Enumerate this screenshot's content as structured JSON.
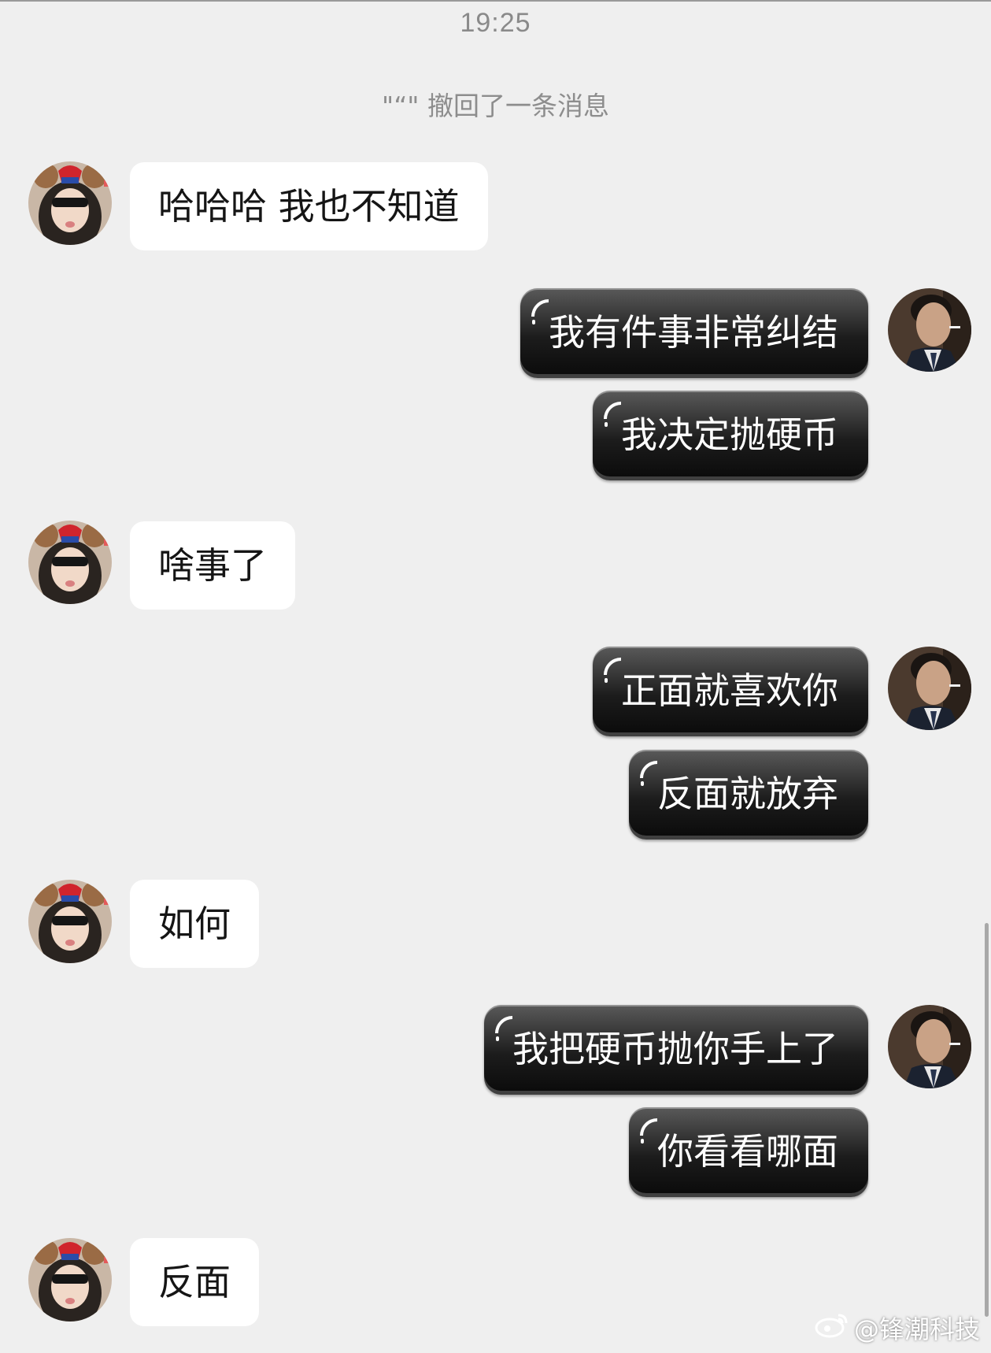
{
  "status": {
    "time": "19:25"
  },
  "system_notice": "\"“\" 撤回了一条消息",
  "messages": [
    {
      "side": "left",
      "text": "哈哈哈 我也不知道"
    },
    {
      "side": "right",
      "text": "我有件事非常纠结"
    },
    {
      "side": "right",
      "text": "我决定抛硬币"
    },
    {
      "side": "left",
      "text": "啥事了"
    },
    {
      "side": "right",
      "text": "正面就喜欢你"
    },
    {
      "side": "right",
      "text": "反面就放弃"
    },
    {
      "side": "left",
      "text": "如何"
    },
    {
      "side": "right",
      "text": "我把硬币抛你手上了"
    },
    {
      "side": "right",
      "text": "你看看哪面"
    },
    {
      "side": "left",
      "text": "反面"
    }
  ],
  "watermark": {
    "text": "@锋潮科技",
    "icon": "weibo-icon"
  },
  "avatars": {
    "left": "girl-avatar",
    "right": "man-avatar"
  },
  "colors": {
    "background": "#efefef",
    "incoming_bubble": "#ffffff",
    "outgoing_bubble": "#1c1c1c"
  }
}
